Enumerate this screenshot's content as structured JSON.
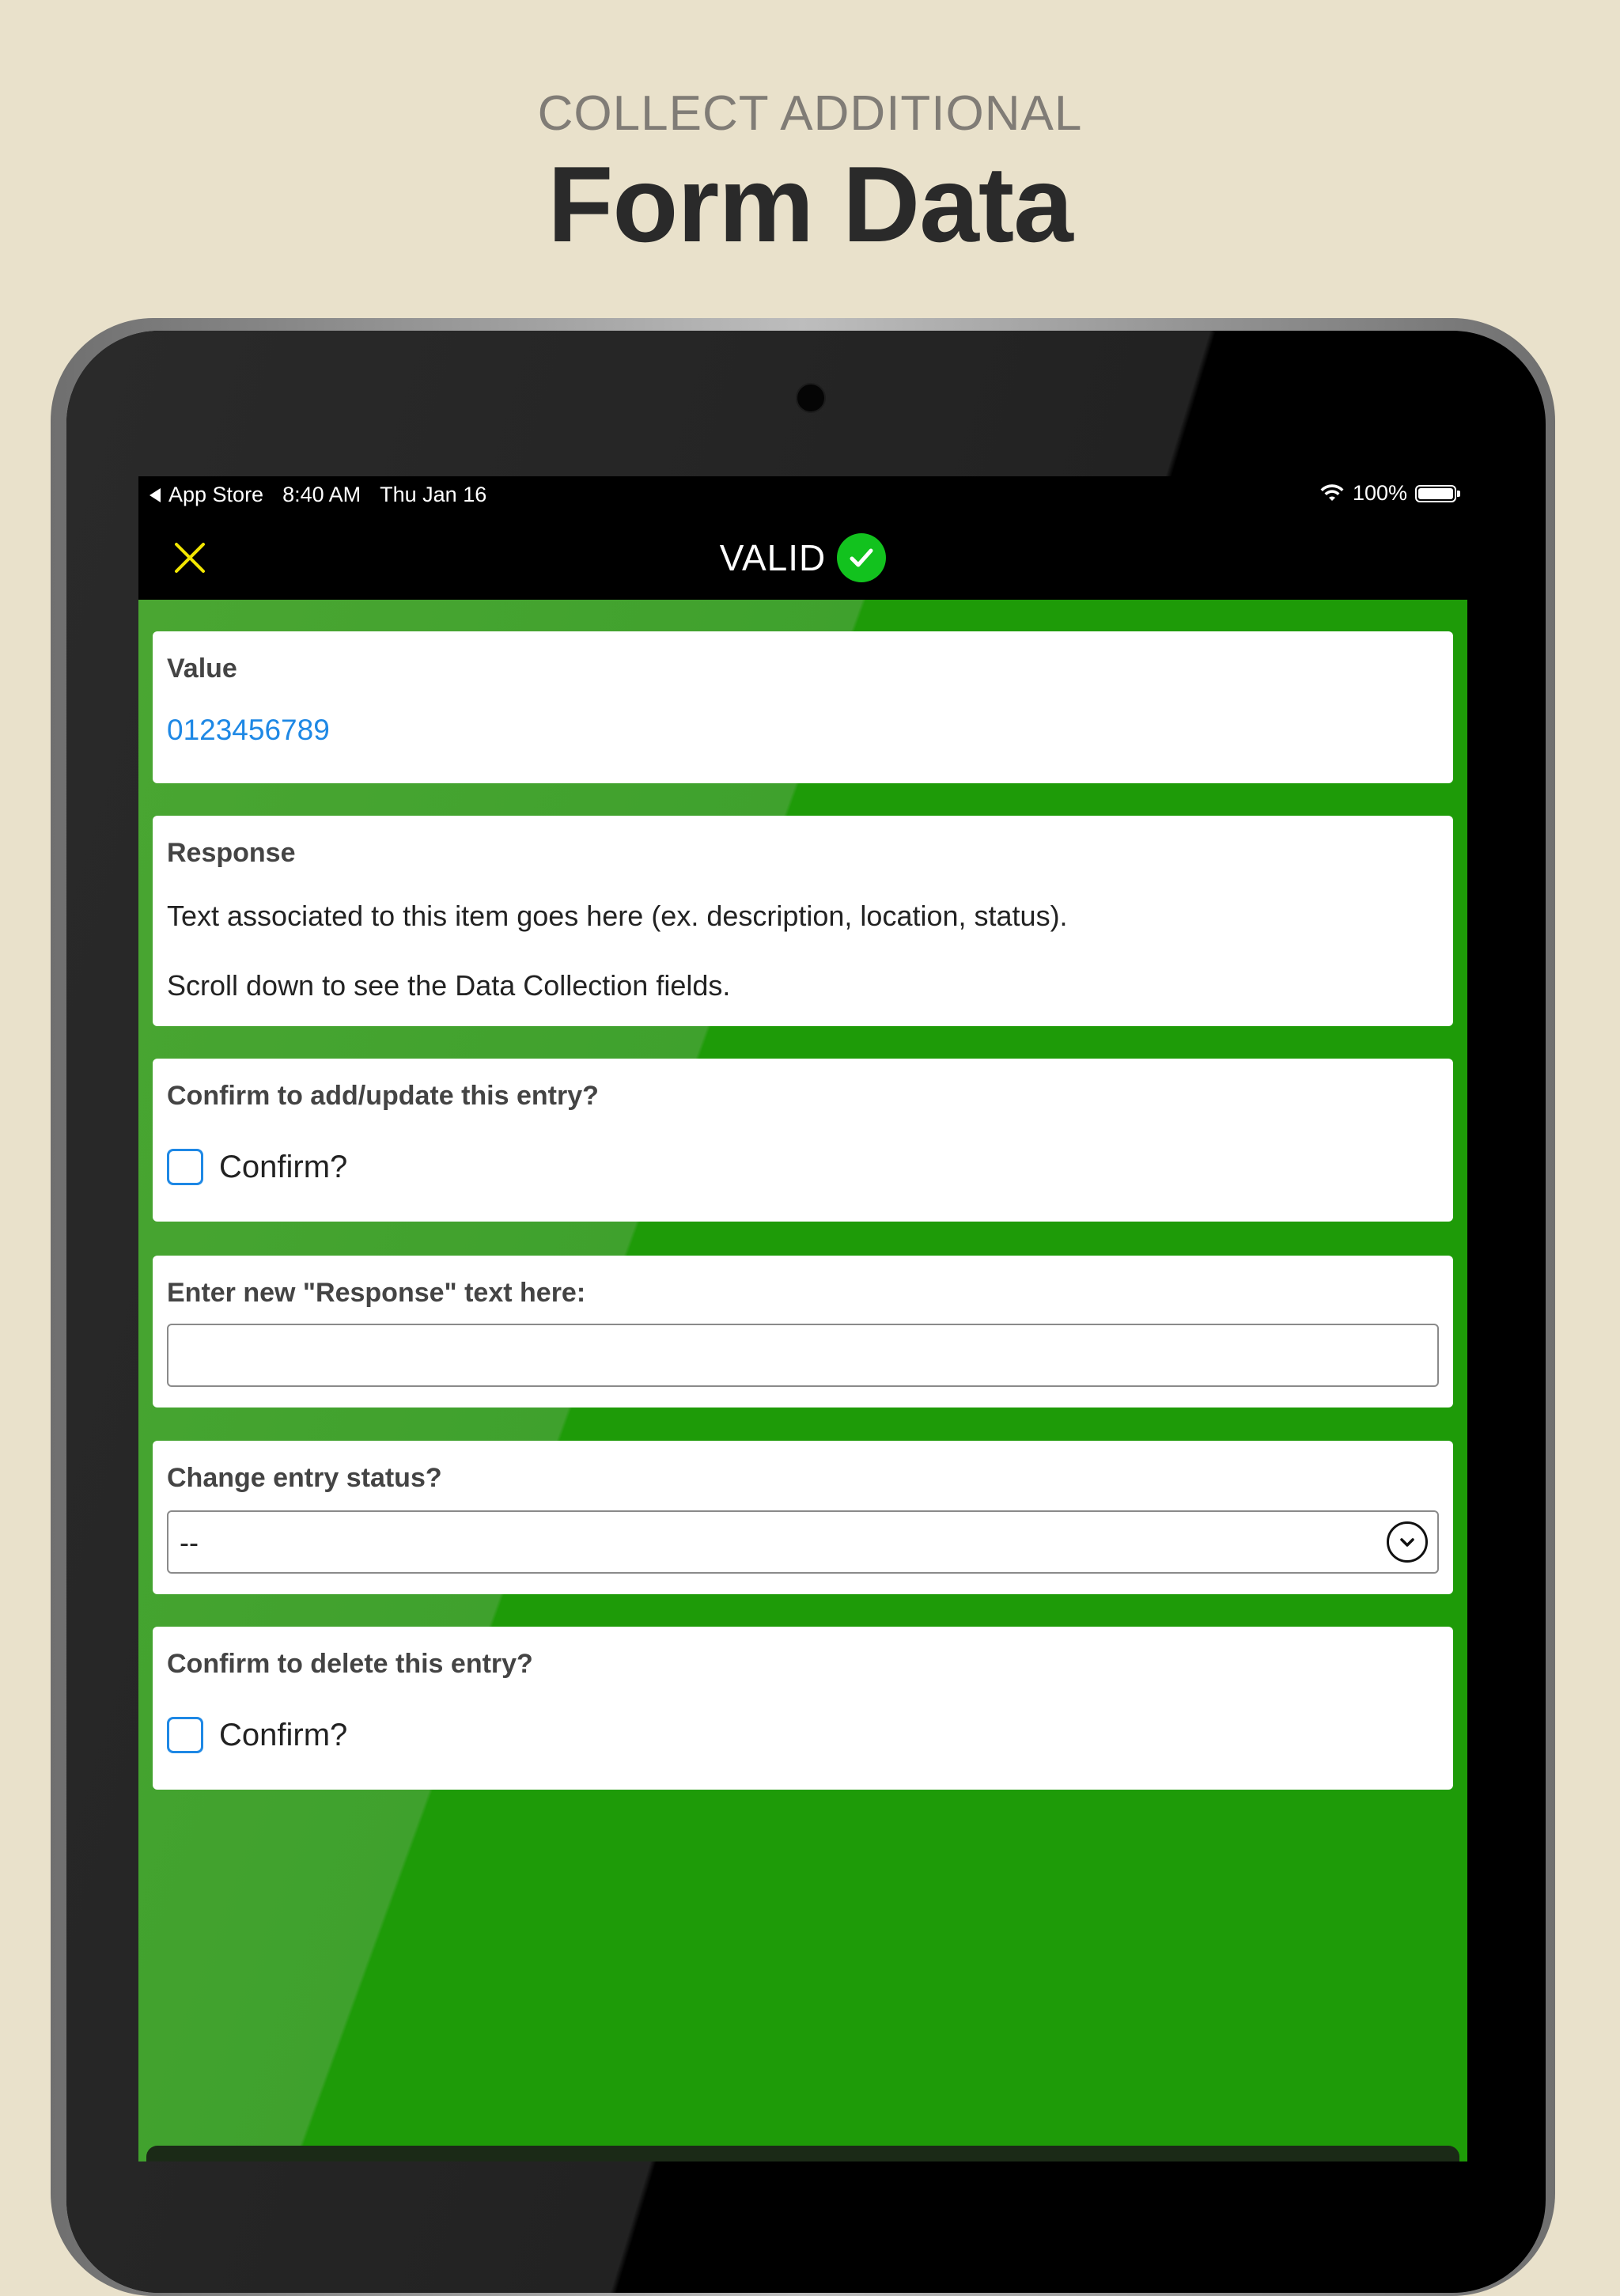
{
  "promo": {
    "subtitle": "COLLECT ADDITIONAL",
    "title": "Form Data"
  },
  "status_bar": {
    "back_app": "App Store",
    "time": "8:40 AM",
    "date": "Thu Jan 16",
    "battery": "100%",
    "battery_level": 1.0
  },
  "nav": {
    "close_icon": "close-x-icon",
    "title": "VALID",
    "status_icon": "checkmark-circle-icon",
    "accent_color": "#f2e600",
    "status_color": "#12c21e"
  },
  "cards": {
    "value": {
      "label": "Value",
      "value": "0123456789"
    },
    "response": {
      "label": "Response",
      "line1": "Text associated to this item goes here (ex. description, location, status).",
      "line2": "Scroll down to see the Data Collection fields."
    },
    "confirm_update": {
      "label": "Confirm to add/update this entry?",
      "checkbox_label": "Confirm?",
      "checked": false
    },
    "new_response": {
      "label": "Enter new \"Response\" text here:",
      "value": "",
      "placeholder": ""
    },
    "change_status": {
      "label": "Change entry status?",
      "selected": "--"
    },
    "confirm_delete": {
      "label": "Confirm to delete this entry?",
      "checkbox_label": "Confirm?",
      "checked": false
    }
  },
  "colors": {
    "background": "#e9e1cb",
    "screen_green": "#1e9b08",
    "link_blue": "#1e88e5"
  }
}
